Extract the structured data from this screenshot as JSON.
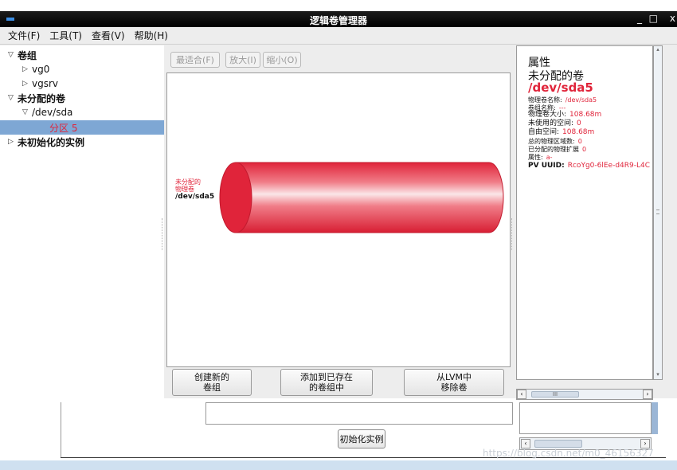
{
  "window": {
    "title": "逻辑卷管理器",
    "minimize": "_",
    "maximize": "□",
    "close": "x"
  },
  "menubar": [
    "文件(F)",
    "工具(T)",
    "查看(V)",
    "帮助(H)"
  ],
  "tree": {
    "volume_groups": "卷组",
    "vg0": "vg0",
    "vgsrv": "vgsrv",
    "unallocated": "未分配的卷",
    "dev_sda": "/dev/sda",
    "partition": "分区 5",
    "uninitialized": "未初始化的实例"
  },
  "toolbar": {
    "best_fit": "最适合(F)",
    "zoom_in": "放大(I)",
    "zoom_out": "缩小(O)"
  },
  "canvas": {
    "label_line1": "未分配的",
    "label_line2": "物理卷",
    "label_dev": "/dev/sda5"
  },
  "actions": {
    "create_line1": "创建新的",
    "create_line2": "卷组",
    "add_line1": "添加到已存在",
    "add_line2": "的卷组中",
    "remove_line1": "从LVM中",
    "remove_line2": "移除卷"
  },
  "properties": {
    "title": "属性",
    "subtitle": "未分配的卷",
    "device": "/dev/sda5",
    "rows": [
      {
        "key": "物理卷名称:",
        "value": "/dev/sda5"
      },
      {
        "key": "卷组名称:",
        "value": "---"
      },
      {
        "key": "物理卷大小:",
        "value": "108.68m"
      },
      {
        "key": "未使用的空间:",
        "value": "0"
      },
      {
        "key": "自由空间:",
        "value": "108.68m"
      },
      {
        "key": "总的物理区域数:",
        "value": "0"
      },
      {
        "key": "已分配的物理扩展",
        "value": "0"
      },
      {
        "key": "属性:",
        "value": "a-"
      }
    ],
    "uuid_key": "PV UUID:",
    "uuid_value": "RcoYg0-6lEe-d4R9-L4C"
  },
  "background": {
    "init_button": "初始化实例",
    "watermark": "https://blog.csdn.net/m0_46156327"
  },
  "colors": {
    "accent_red": "#e0243a",
    "selection": "#7ea7d4",
    "titlebar": "#000000"
  }
}
